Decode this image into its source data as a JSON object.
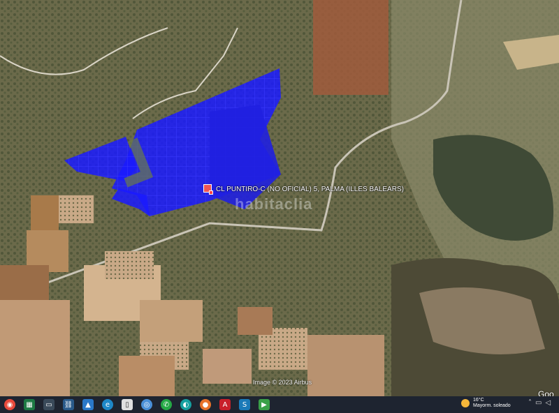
{
  "map": {
    "place_label": "CL PUNTIRO-C (NO OFICIAL) 5, PALMA (ILLES BALEARS)",
    "watermark": "habitaclia",
    "credit": "Image © 2023 Airbus",
    "provider": "Goo",
    "colors": {
      "parcel_fill": "#1a1aff",
      "parcel_stroke": "#2d2dff",
      "highlight": "#a05a3c"
    }
  },
  "taskbar": {
    "icons": [
      "start-icon",
      "excel-icon",
      "presentation-icon",
      "network-icon",
      "photos-icon",
      "edge-icon",
      "file-icon",
      "chrome-icon",
      "whatsapp-icon",
      "app-icon",
      "firefox-icon",
      "acrobat-icon",
      "sharepoint-icon",
      "project-icon"
    ],
    "weather": {
      "temp": "16°C",
      "condition": "Mayorm. soleado"
    }
  }
}
